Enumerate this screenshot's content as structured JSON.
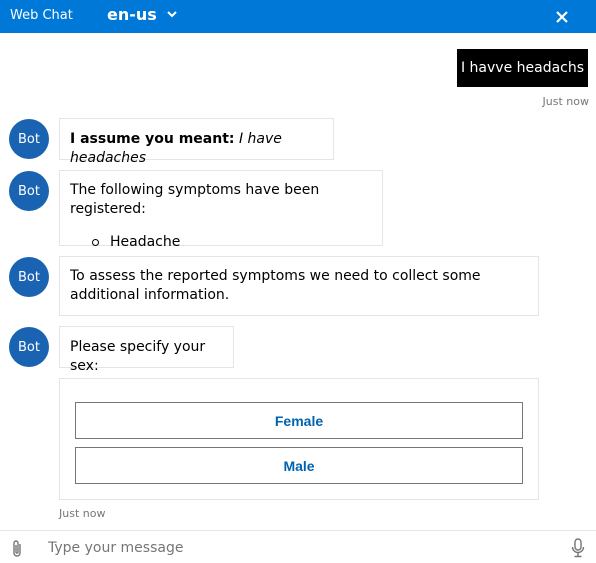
{
  "header": {
    "title": "Web Chat",
    "language": "en-us",
    "colors": {
      "background": "#0078d7",
      "text": "#ffffff"
    },
    "icons": {
      "language_dropdown": "chevron-down-icon",
      "close": "close-icon"
    }
  },
  "messages": {
    "user": [
      {
        "text": "I havve headachs",
        "timestamp": "Just now"
      }
    ],
    "bot": {
      "avatar_label": "Bot",
      "avatar_color": "#1a63b3",
      "correction_prefix": "I assume you meant:",
      "correction_text": "I have headaches",
      "symptoms_intro": "The following symptoms have been registered:",
      "symptoms": [
        "Headache"
      ],
      "assess_text": "To assess the reported symptoms we need to collect some additional information.",
      "sex_prompt": "Please specify your sex:",
      "choices": [
        "Female",
        "Male"
      ],
      "timestamp": "Just now"
    }
  },
  "composer": {
    "placeholder": "Type your message",
    "icons": {
      "attach": "paperclip-icon",
      "microphone": "microphone-icon"
    }
  }
}
